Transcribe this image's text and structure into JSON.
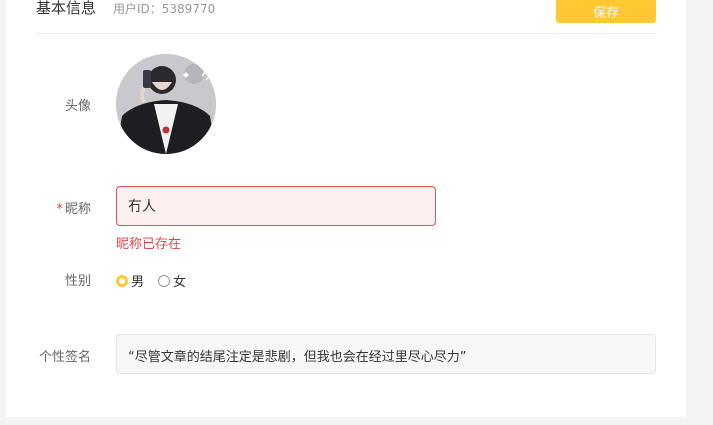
{
  "header": {
    "title": "基本信息",
    "user_id": "用户ID：5389770",
    "save_label": "保存"
  },
  "form": {
    "avatar_label": "头像",
    "nickname": {
      "required_mark": "*",
      "label": "昵称",
      "value": "冇人",
      "error": "昵称已存在"
    },
    "gender": {
      "label": "性别",
      "options": [
        "男",
        "女"
      ],
      "selected": "男"
    },
    "signature": {
      "label": "个性签名",
      "value": "“尽管文章的结尾注定是悲剧，但我也会在经过里尽心尽力”"
    }
  },
  "colors": {
    "accent": "#ffc832",
    "error": "#e04848",
    "error_bg": "#fff0f0"
  }
}
